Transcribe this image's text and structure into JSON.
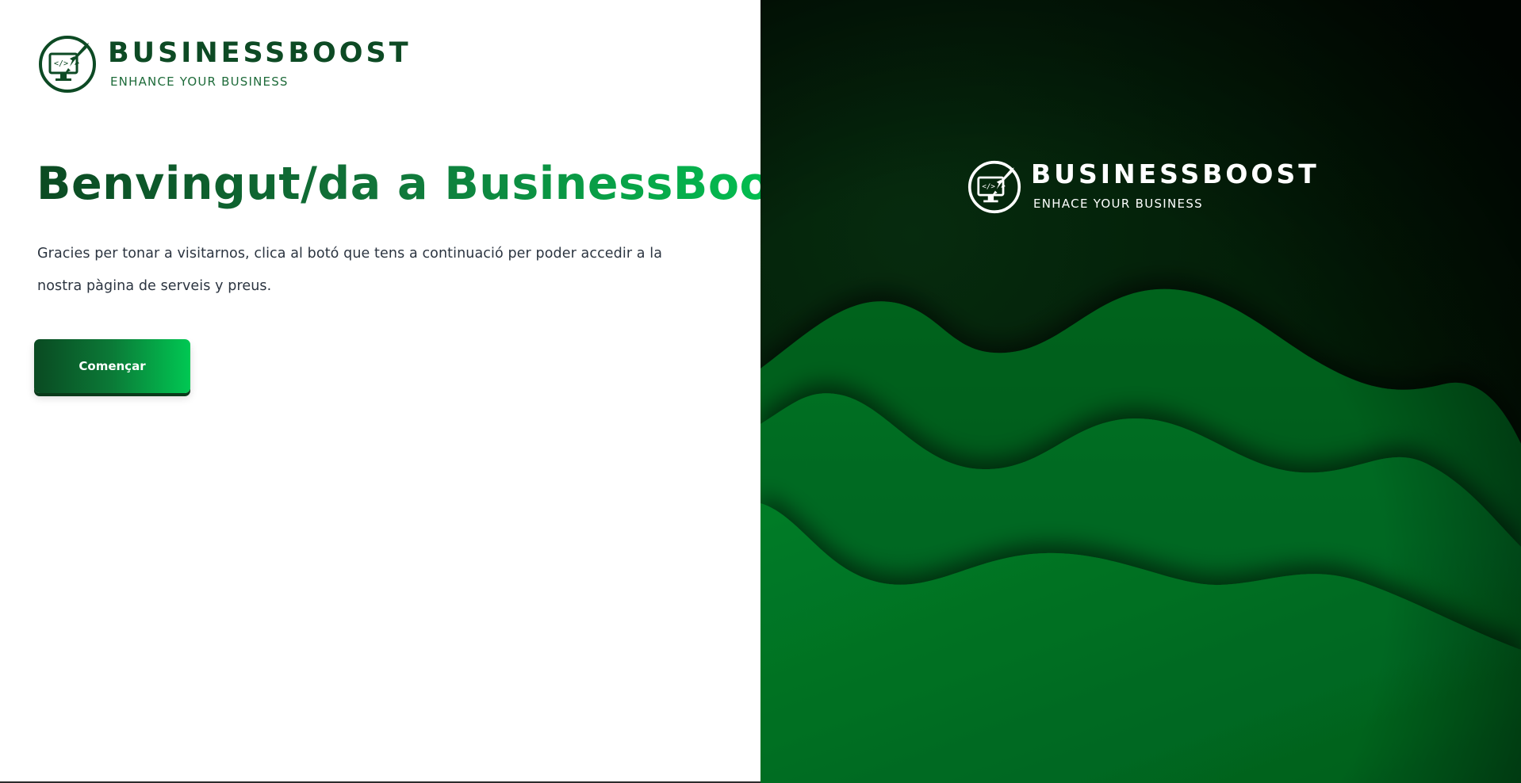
{
  "brand": {
    "name": "BUSINESSBOOST",
    "tagline": "ENHANCE YOUR BUSINESS",
    "logo_icon": "rocket-monitor-logo-icon"
  },
  "welcome": {
    "headline": "Benvingut/da a BusinessBoost",
    "intro": "Gracies per tonar a visitarnos, clica al botó que tens a continuació per poder accedir a la nostra pàgina de serveis y preus.",
    "cta_label": "Començar"
  },
  "hero": {
    "brand_name": "BUSINESSBOOST",
    "brand_tagline": "ENHACE YOUR BUSINESS",
    "logo_icon": "rocket-monitor-logo-icon"
  },
  "colors": {
    "brand_dark": "#0d4a24",
    "accent": "#00c853",
    "hero_background": "#021a06",
    "wave_green": "#0b7a2a"
  }
}
